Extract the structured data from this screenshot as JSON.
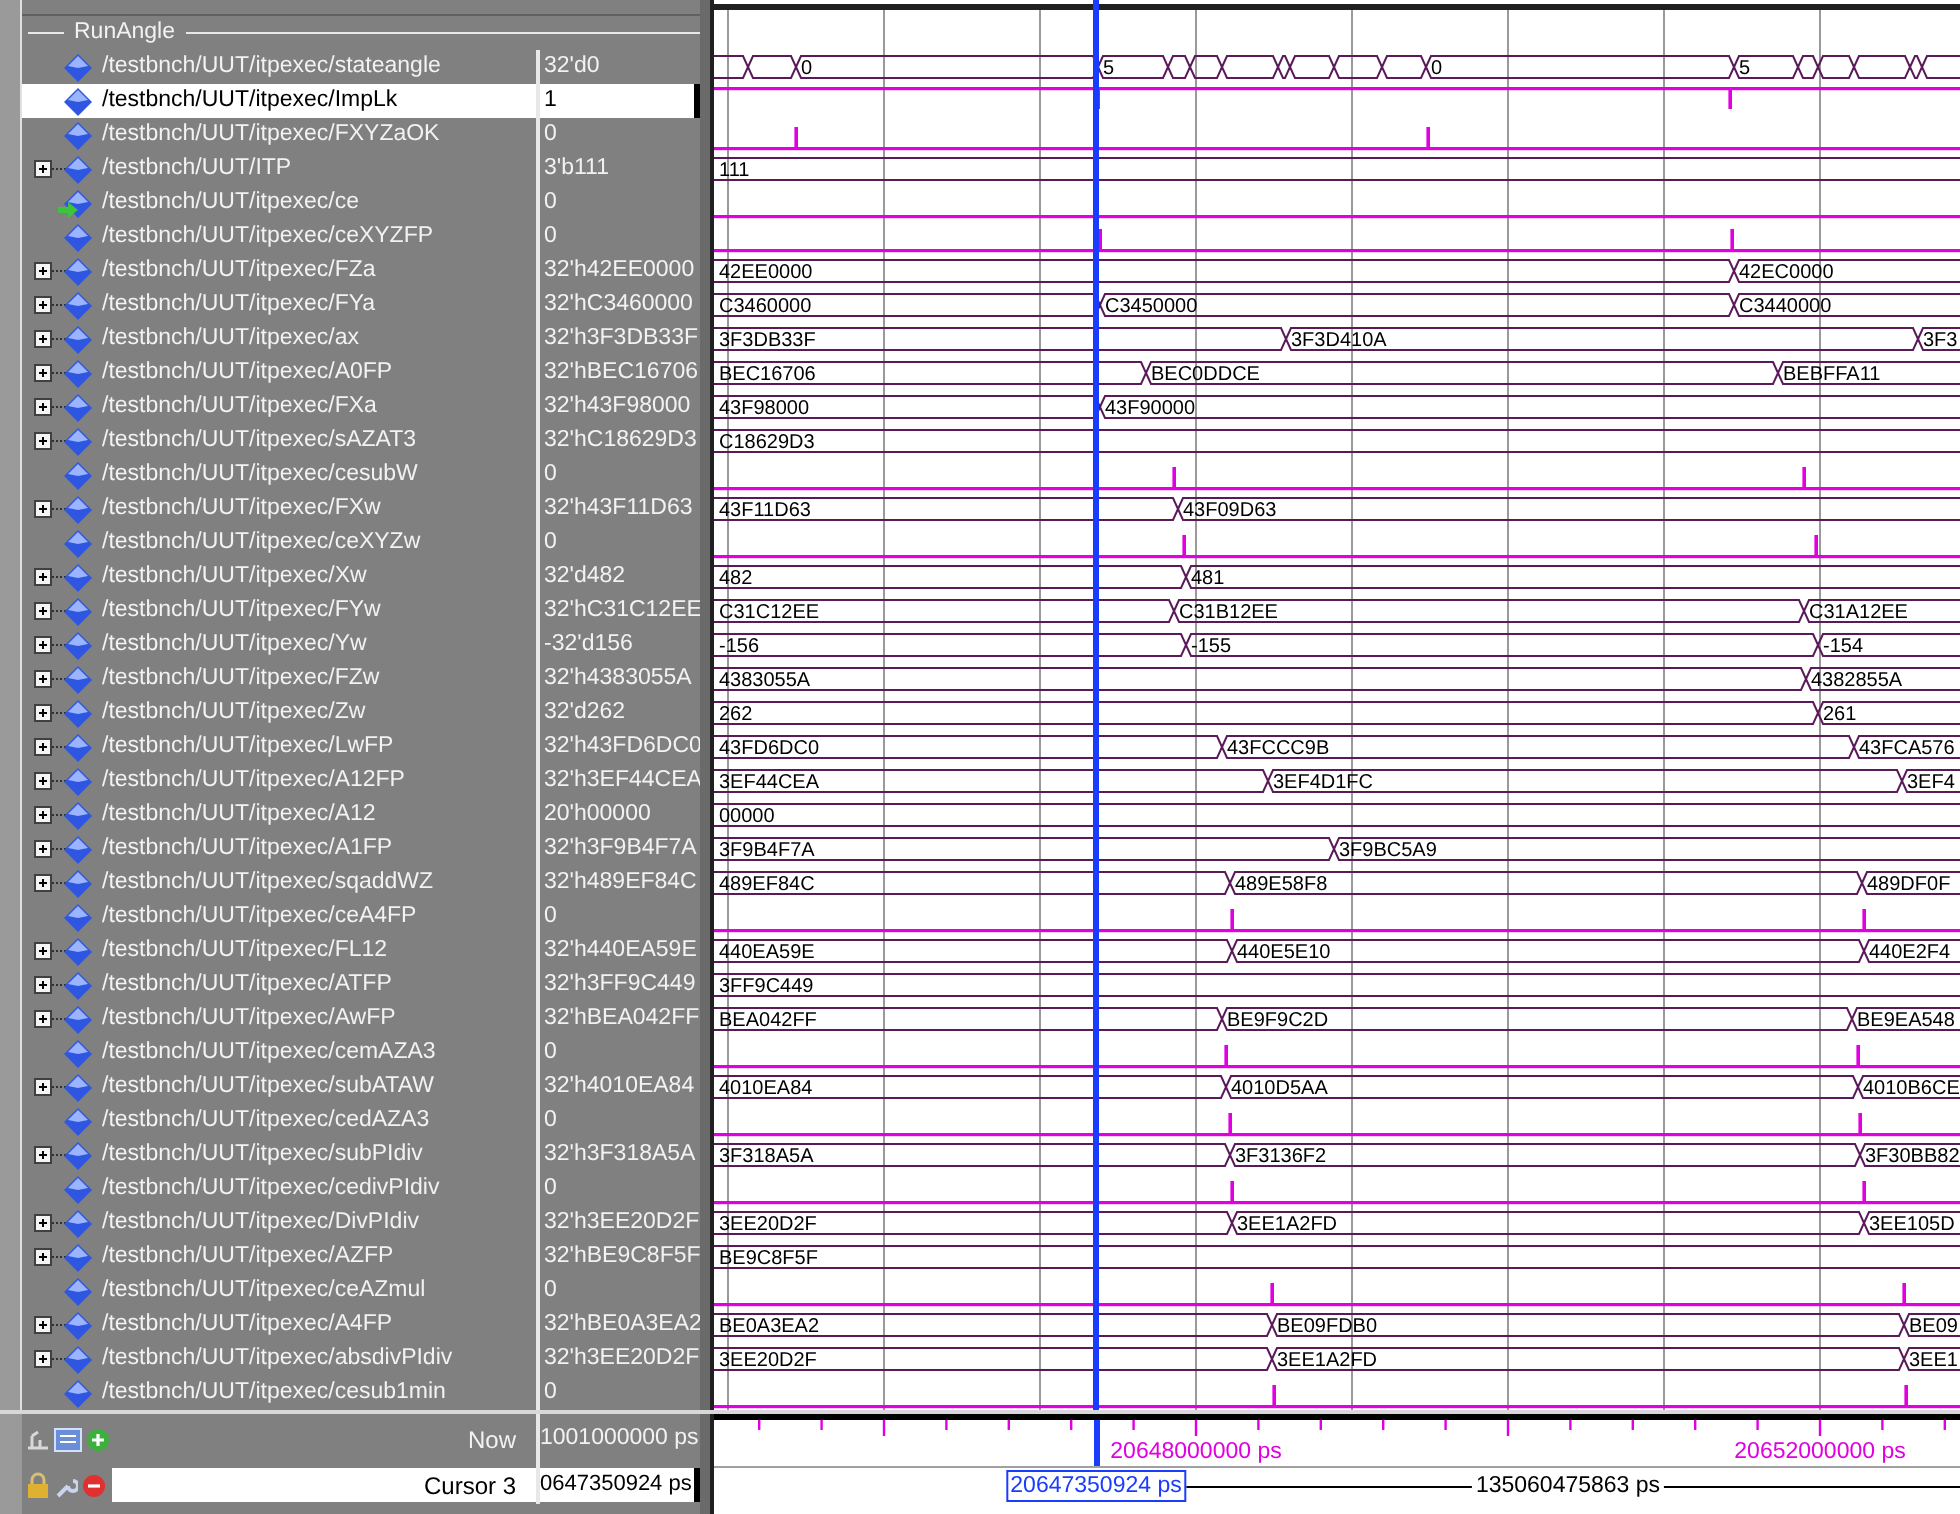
{
  "group": {
    "label": "RunAngle"
  },
  "signals": [
    {
      "name": "/testbnch/UUT/itpexec/stateangle",
      "value": "32'd0",
      "kind": "bus",
      "expandable": false,
      "selected": false,
      "pointer": false,
      "labels": [
        "0",
        "5",
        "0",
        "5"
      ]
    },
    {
      "name": "/testbnch/UUT/itpexec/ImpLk",
      "value": "1",
      "kind": "bit",
      "expandable": false,
      "selected": true,
      "pointer": false,
      "high": true
    },
    {
      "name": "/testbnch/UUT/itpexec/FXYZaOK",
      "value": "0",
      "kind": "bit",
      "expandable": false,
      "selected": false,
      "pointer": false,
      "high": false
    },
    {
      "name": "/testbnch/UUT/ITP",
      "value": "3'b111",
      "kind": "bus",
      "expandable": true,
      "selected": false,
      "pointer": false,
      "labels": [
        "111"
      ]
    },
    {
      "name": "/testbnch/UUT/itpexec/ce",
      "value": "0",
      "kind": "bit",
      "expandable": false,
      "selected": false,
      "pointer": true,
      "high": false
    },
    {
      "name": "/testbnch/UUT/itpexec/ceXYZFP",
      "value": "0",
      "kind": "bit",
      "expandable": false,
      "selected": false,
      "pointer": false,
      "high": false
    },
    {
      "name": "/testbnch/UUT/itpexec/FZa",
      "value": "32'h42EE0000",
      "kind": "bus",
      "expandable": true,
      "selected": false,
      "pointer": false,
      "labels": [
        "42EE0000",
        "42EC0000"
      ]
    },
    {
      "name": "/testbnch/UUT/itpexec/FYa",
      "value": "32'hC3460000",
      "kind": "bus",
      "expandable": true,
      "selected": false,
      "pointer": false,
      "labels": [
        "C3460000",
        "C3450000",
        "C3440000"
      ]
    },
    {
      "name": "/testbnch/UUT/itpexec/ax",
      "value": "32'h3F3DB33F",
      "kind": "bus",
      "expandable": true,
      "selected": false,
      "pointer": false,
      "labels": [
        "3F3DB33F",
        "3F3D410A",
        "3F3"
      ]
    },
    {
      "name": "/testbnch/UUT/itpexec/A0FP",
      "value": "32'hBEC16706",
      "kind": "bus",
      "expandable": true,
      "selected": false,
      "pointer": false,
      "labels": [
        "BEC16706",
        "BEC0DDCE",
        "BEBFFA11"
      ]
    },
    {
      "name": "/testbnch/UUT/itpexec/FXa",
      "value": "32'h43F98000",
      "kind": "bus",
      "expandable": true,
      "selected": false,
      "pointer": false,
      "labels": [
        "43F98000",
        "43F90000"
      ]
    },
    {
      "name": "/testbnch/UUT/itpexec/sAZAT3",
      "value": "32'hC18629D3",
      "kind": "bus",
      "expandable": true,
      "selected": false,
      "pointer": false,
      "labels": [
        "C18629D3"
      ]
    },
    {
      "name": "/testbnch/UUT/itpexec/cesubW",
      "value": "0",
      "kind": "bit",
      "expandable": false,
      "selected": false,
      "pointer": false,
      "high": false
    },
    {
      "name": "/testbnch/UUT/itpexec/FXw",
      "value": "32'h43F11D63",
      "kind": "bus",
      "expandable": true,
      "selected": false,
      "pointer": false,
      "labels": [
        "43F11D63",
        "43F09D63"
      ]
    },
    {
      "name": "/testbnch/UUT/itpexec/ceXYZw",
      "value": "0",
      "kind": "bit",
      "expandable": false,
      "selected": false,
      "pointer": false,
      "high": false
    },
    {
      "name": "/testbnch/UUT/itpexec/Xw",
      "value": "32'd482",
      "kind": "bus",
      "expandable": true,
      "selected": false,
      "pointer": false,
      "labels": [
        "482",
        "481"
      ]
    },
    {
      "name": "/testbnch/UUT/itpexec/FYw",
      "value": "32'hC31C12EE",
      "kind": "bus",
      "expandable": true,
      "selected": false,
      "pointer": false,
      "labels": [
        "C31C12EE",
        "C31B12EE",
        "C31A12EE"
      ]
    },
    {
      "name": "/testbnch/UUT/itpexec/Yw",
      "value": "-32'd156",
      "kind": "bus",
      "expandable": true,
      "selected": false,
      "pointer": false,
      "labels": [
        "-156",
        "-155",
        "-154"
      ]
    },
    {
      "name": "/testbnch/UUT/itpexec/FZw",
      "value": "32'h4383055A",
      "kind": "bus",
      "expandable": true,
      "selected": false,
      "pointer": false,
      "labels": [
        "4383055A",
        "4382855A"
      ]
    },
    {
      "name": "/testbnch/UUT/itpexec/Zw",
      "value": "32'd262",
      "kind": "bus",
      "expandable": true,
      "selected": false,
      "pointer": false,
      "labels": [
        "262",
        "261"
      ]
    },
    {
      "name": "/testbnch/UUT/itpexec/LwFP",
      "value": "32'h43FD6DC0",
      "kind": "bus",
      "expandable": true,
      "selected": false,
      "pointer": false,
      "labels": [
        "43FD6DC0",
        "43FCCC9B",
        "43FCA576"
      ]
    },
    {
      "name": "/testbnch/UUT/itpexec/A12FP",
      "value": "32'h3EF44CEA",
      "kind": "bus",
      "expandable": true,
      "selected": false,
      "pointer": false,
      "labels": [
        "3EF44CEA",
        "3EF4D1FC",
        "3EF4"
      ]
    },
    {
      "name": "/testbnch/UUT/itpexec/A12",
      "value": "20'h00000",
      "kind": "bus",
      "expandable": true,
      "selected": false,
      "pointer": false,
      "labels": [
        "00000"
      ]
    },
    {
      "name": "/testbnch/UUT/itpexec/A1FP",
      "value": "32'h3F9B4F7A",
      "kind": "bus",
      "expandable": true,
      "selected": false,
      "pointer": false,
      "labels": [
        "3F9B4F7A",
        "3F9BC5A9"
      ]
    },
    {
      "name": "/testbnch/UUT/itpexec/sqaddWZ",
      "value": "32'h489EF84C",
      "kind": "bus",
      "expandable": true,
      "selected": false,
      "pointer": false,
      "labels": [
        "489EF84C",
        "489E58F8",
        "489DF0F"
      ]
    },
    {
      "name": "/testbnch/UUT/itpexec/ceA4FP",
      "value": "0",
      "kind": "bit",
      "expandable": false,
      "selected": false,
      "pointer": false,
      "high": false
    },
    {
      "name": "/testbnch/UUT/itpexec/FL12",
      "value": "32'h440EA59E",
      "kind": "bus",
      "expandable": true,
      "selected": false,
      "pointer": false,
      "labels": [
        "440EA59E",
        "440E5E10",
        "440E2F4"
      ]
    },
    {
      "name": "/testbnch/UUT/itpexec/ATFP",
      "value": "32'h3FF9C449",
      "kind": "bus",
      "expandable": true,
      "selected": false,
      "pointer": false,
      "labels": [
        "3FF9C449"
      ]
    },
    {
      "name": "/testbnch/UUT/itpexec/AwFP",
      "value": "32'hBEA042FF",
      "kind": "bus",
      "expandable": true,
      "selected": false,
      "pointer": false,
      "labels": [
        "BEA042FF",
        "BE9F9C2D",
        "BE9EA548"
      ]
    },
    {
      "name": "/testbnch/UUT/itpexec/cemAZA3",
      "value": "0",
      "kind": "bit",
      "expandable": false,
      "selected": false,
      "pointer": false,
      "high": false
    },
    {
      "name": "/testbnch/UUT/itpexec/subATAW",
      "value": "32'h4010EA84",
      "kind": "bus",
      "expandable": true,
      "selected": false,
      "pointer": false,
      "labels": [
        "4010EA84",
        "4010D5AA",
        "4010B6CE"
      ]
    },
    {
      "name": "/testbnch/UUT/itpexec/cedAZA3",
      "value": "0",
      "kind": "bit",
      "expandable": false,
      "selected": false,
      "pointer": false,
      "high": false
    },
    {
      "name": "/testbnch/UUT/itpexec/subPIdiv",
      "value": "32'h3F318A5A",
      "kind": "bus",
      "expandable": true,
      "selected": false,
      "pointer": false,
      "labels": [
        "3F318A5A",
        "3F3136F2",
        "3F30BB82"
      ]
    },
    {
      "name": "/testbnch/UUT/itpexec/cedivPIdiv",
      "value": "0",
      "kind": "bit",
      "expandable": false,
      "selected": false,
      "pointer": false,
      "high": false
    },
    {
      "name": "/testbnch/UUT/itpexec/DivPIdiv",
      "value": "32'h3EE20D2F",
      "kind": "bus",
      "expandable": true,
      "selected": false,
      "pointer": false,
      "labels": [
        "3EE20D2F",
        "3EE1A2FD",
        "3EE105D"
      ]
    },
    {
      "name": "/testbnch/UUT/itpexec/AZFP",
      "value": "32'hBE9C8F5F",
      "kind": "bus",
      "expandable": true,
      "selected": false,
      "pointer": false,
      "labels": [
        "BE9C8F5F"
      ]
    },
    {
      "name": "/testbnch/UUT/itpexec/ceAZmul",
      "value": "0",
      "kind": "bit",
      "expandable": false,
      "selected": false,
      "pointer": false,
      "high": false
    },
    {
      "name": "/testbnch/UUT/itpexec/A4FP",
      "value": "32'hBE0A3EA2",
      "kind": "bus",
      "expandable": true,
      "selected": false,
      "pointer": false,
      "labels": [
        "BE0A3EA2",
        "BE09FDB0",
        "BE09"
      ]
    },
    {
      "name": "/testbnch/UUT/itpexec/absdivPIdiv",
      "value": "32'h3EE20D2F",
      "kind": "bus",
      "expandable": true,
      "selected": false,
      "pointer": false,
      "labels": [
        "3EE20D2F",
        "3EE1A2FD",
        "3EE1"
      ]
    },
    {
      "name": "/testbnch/UUT/itpexec/cesub1min",
      "value": "0",
      "kind": "bit",
      "expandable": false,
      "selected": false,
      "pointer": false,
      "high": false
    }
  ],
  "ruler": [
    "20648000000 ps",
    "20652000000 ps"
  ],
  "now": {
    "label": "Now",
    "value": "1001000000 ps"
  },
  "cursor": {
    "label": "Cursor 3",
    "value": "0647350924 ps",
    "time": "20647350924 ps",
    "delta": "135060475863 ps"
  }
}
